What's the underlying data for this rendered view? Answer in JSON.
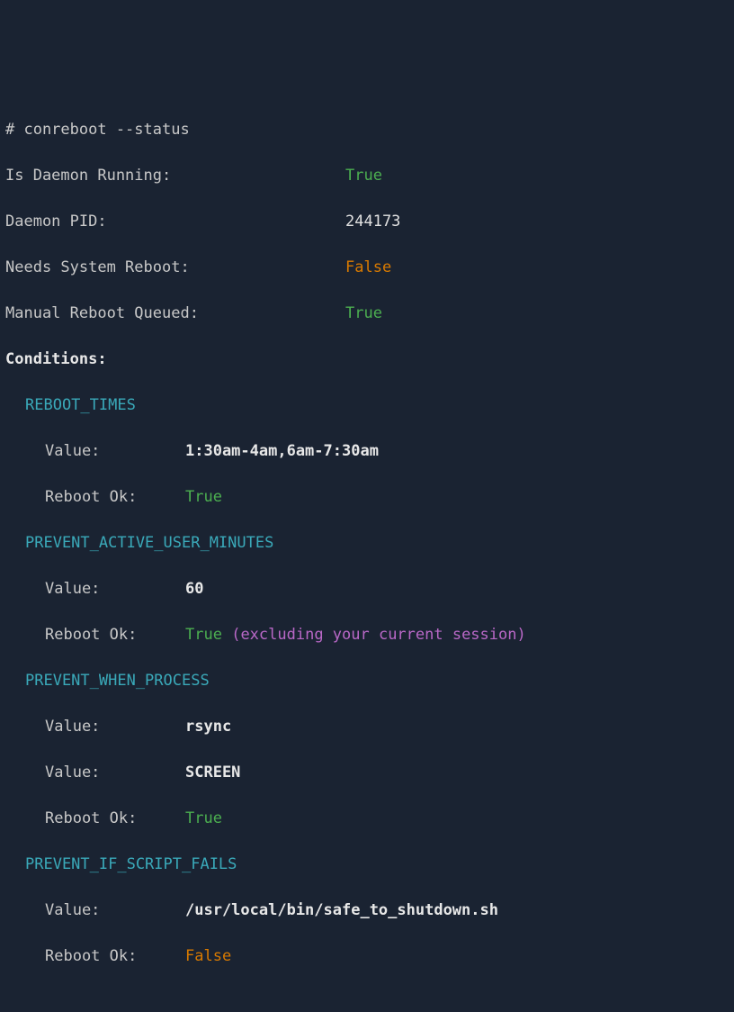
{
  "command": "# conreboot --status",
  "status": {
    "daemon_running_label": "Is Daemon Running:",
    "daemon_running": "True",
    "daemon_pid_label": "Daemon PID:",
    "daemon_pid": "244173",
    "needs_reboot_label": "Needs System Reboot:",
    "needs_reboot": "False",
    "manual_queued_label": "Manual Reboot Queued:",
    "manual_queued": "True"
  },
  "conditions_header": "Conditions:",
  "conditions": [
    {
      "name": "REBOOT_TIMES",
      "values": [
        {
          "label": "Value:",
          "text": "1:30am-4am,6am-7:30am"
        }
      ],
      "reboot_ok_label": "Reboot Ok:",
      "reboot_ok": "True",
      "note": ""
    },
    {
      "name": "PREVENT_ACTIVE_USER_MINUTES",
      "values": [
        {
          "label": "Value:",
          "text": "60"
        }
      ],
      "reboot_ok_label": "Reboot Ok:",
      "reboot_ok": "True",
      "note": "(excluding your current session)"
    },
    {
      "name": "PREVENT_WHEN_PROCESS",
      "values": [
        {
          "label": "Value:",
          "text": "rsync"
        },
        {
          "label": "Value:",
          "text": "SCREEN"
        }
      ],
      "reboot_ok_label": "Reboot Ok:",
      "reboot_ok": "True",
      "note": ""
    },
    {
      "name": "PREVENT_IF_SCRIPT_FAILS",
      "values": [
        {
          "label": "Value:",
          "text": "/usr/local/bin/safe_to_shutdown.sh"
        }
      ],
      "reboot_ok_label": "Reboot Ok:",
      "reboot_ok": "False",
      "note": ""
    }
  ]
}
